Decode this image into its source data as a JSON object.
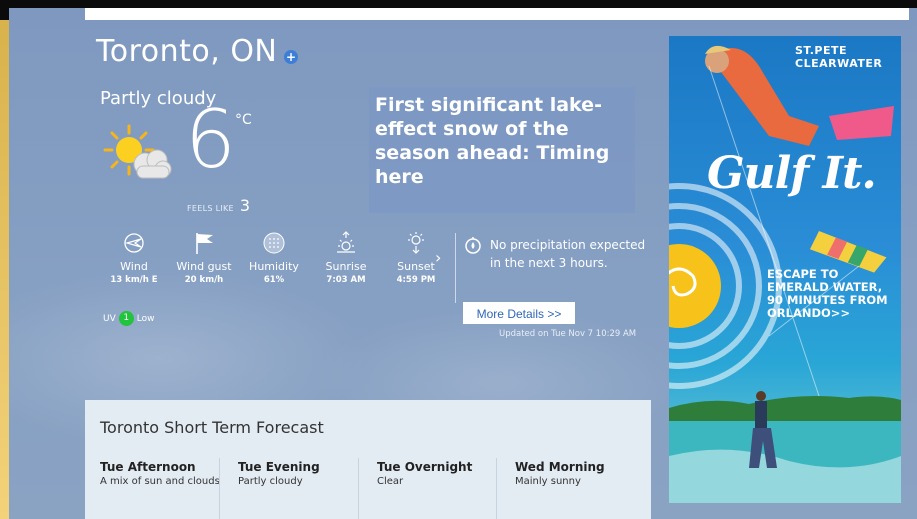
{
  "location": {
    "city": "Toronto, ON"
  },
  "current": {
    "condition": "Partly cloudy",
    "temperature": "6",
    "unit": "°C",
    "feels_like_label": "FEELS LIKE",
    "feels_like_value": "3"
  },
  "news": {
    "headline": "First significant lake-effect snow of the season ahead: Timing here"
  },
  "metrics": [
    {
      "label": "Wind",
      "value": "13 km/h E",
      "icon": "wind-icon"
    },
    {
      "label": "Wind gust",
      "value": "20 km/h",
      "icon": "flag-icon"
    },
    {
      "label": "Humidity",
      "value": "61%",
      "icon": "humidity-icon"
    },
    {
      "label": "Sunrise",
      "value": "7:03 AM",
      "icon": "sunrise-icon"
    },
    {
      "label": "Sunset",
      "value": "4:59 PM",
      "icon": "sunset-icon"
    }
  ],
  "uv": {
    "label": "UV",
    "index": "1",
    "level": "Low"
  },
  "precip": {
    "text": "No precipitation expected in the next 3 hours.",
    "more_details": "More Details >>",
    "updated": "Updated on Tue Nov 7 10:29 AM"
  },
  "forecast": {
    "title": "Toronto Short Term Forecast",
    "periods": [
      {
        "name": "Tue Afternoon",
        "desc": "A mix of sun and clouds"
      },
      {
        "name": "Tue Evening",
        "desc": "Partly cloudy"
      },
      {
        "name": "Tue Overnight",
        "desc": "Clear"
      },
      {
        "name": "Wed Morning",
        "desc": "Mainly sunny"
      }
    ]
  },
  "ad": {
    "brand_line1": "ST.PETE",
    "brand_line2": "CLEARWATER",
    "headline": "Gulf It.",
    "sub": "ESCAPE TO EMERALD WATER, 90 MINUTES FROM ORLANDO>>"
  },
  "colors": {
    "background": "#859fc3",
    "uv_green": "#22c33d",
    "link_blue": "#2f67b5",
    "forecast_panel": "#e3ebf3"
  }
}
